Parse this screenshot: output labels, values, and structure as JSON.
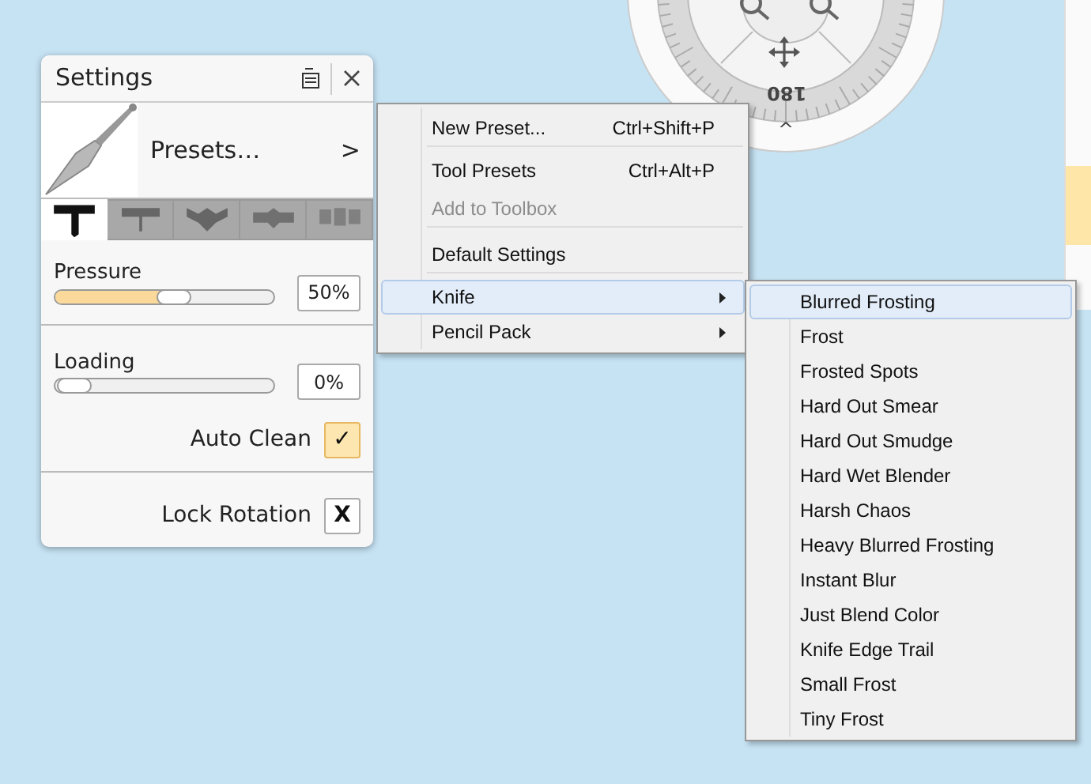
{
  "dial": {
    "angle_label": "180",
    "collapse_glyph": "^"
  },
  "settings": {
    "title": "Settings",
    "presets_label": "Presets…",
    "presets_glyph": ">",
    "brush_tabs": [
      {
        "selected": true
      },
      {
        "selected": false
      },
      {
        "selected": false
      },
      {
        "selected": false
      },
      {
        "selected": false
      }
    ],
    "sliders": [
      {
        "label": "Pressure",
        "level": 0.5,
        "value": "50%"
      },
      {
        "label": "Loading",
        "level": 0.0,
        "value": "0%"
      }
    ],
    "toggles": [
      {
        "label": "Auto Clean",
        "mark": "✓",
        "kind": "tick"
      },
      {
        "label": "Lock Rotation",
        "mark": "X",
        "kind": "cross"
      }
    ]
  },
  "menu": {
    "items": [
      {
        "label": "New Preset...",
        "shortcut": "Ctrl+Shift+P",
        "disabled": false,
        "selected": false,
        "submenu": false,
        "separator_after": true
      },
      {
        "label": "Tool Presets",
        "shortcut": "Ctrl+Alt+P",
        "disabled": false,
        "selected": false,
        "submenu": false,
        "separator_after": false
      },
      {
        "label": "Add to Toolbox",
        "disabled": true,
        "selected": false,
        "submenu": false,
        "separator_after": true
      },
      {
        "label": "Default Settings",
        "disabled": false,
        "selected": false,
        "submenu": false,
        "separator_after": true
      },
      {
        "label": "Knife",
        "disabled": false,
        "selected": true,
        "submenu": true,
        "separator_after": false
      },
      {
        "label": "Pencil Pack",
        "disabled": false,
        "selected": false,
        "submenu": true,
        "separator_after": false
      }
    ]
  },
  "submenu": {
    "items": [
      {
        "label": "Blurred Frosting",
        "selected": true
      },
      {
        "label": "Frost",
        "selected": false
      },
      {
        "label": "Frosted Spots",
        "selected": false
      },
      {
        "label": "Hard Out Smear",
        "selected": false
      },
      {
        "label": "Hard Out Smudge",
        "selected": false
      },
      {
        "label": "Hard Wet Blender",
        "selected": false
      },
      {
        "label": "Harsh Chaos",
        "selected": false
      },
      {
        "label": "Heavy Blurred Frosting",
        "selected": false
      },
      {
        "label": "Instant Blur",
        "selected": false
      },
      {
        "label": "Just Blend Color",
        "selected": false
      },
      {
        "label": "Knife Edge Trail",
        "selected": false
      },
      {
        "label": "Small Frost",
        "selected": false
      },
      {
        "label": "Tiny Frost",
        "selected": false
      }
    ]
  }
}
